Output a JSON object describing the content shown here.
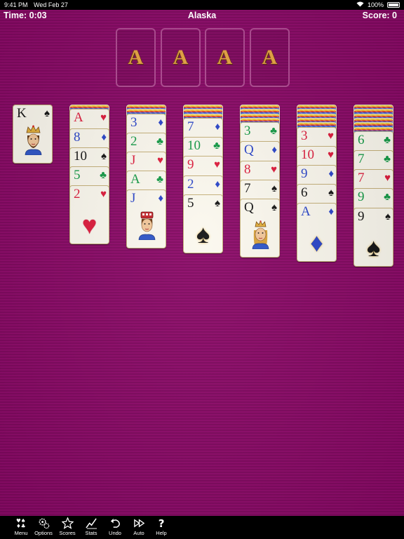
{
  "status": {
    "time": "9:41 PM",
    "date": "Wed Feb 27",
    "battery": "100%"
  },
  "header": {
    "time": "Time: 0:03",
    "title": "Alaska",
    "score": "Score: 0"
  },
  "foundations": [
    "A",
    "A",
    "A",
    "A"
  ],
  "waste": {
    "rank": "K",
    "suit": "♠",
    "face": "king"
  },
  "tableau": [
    {
      "facedown": 1,
      "cards": [
        {
          "rank": "A",
          "suit": "♥"
        },
        {
          "rank": "8",
          "suit": "♦"
        },
        {
          "rank": "10",
          "suit": "♠"
        },
        {
          "rank": "5",
          "suit": "♣"
        },
        {
          "rank": "2",
          "suit": "♥"
        }
      ]
    },
    {
      "facedown": 2,
      "cards": [
        {
          "rank": "3",
          "suit": "♦"
        },
        {
          "rank": "2",
          "suit": "♣"
        },
        {
          "rank": "J",
          "suit": "♥"
        },
        {
          "rank": "A",
          "suit": "♣"
        },
        {
          "rank": "J",
          "suit": "♦",
          "face": "jack"
        }
      ]
    },
    {
      "facedown": 3,
      "cards": [
        {
          "rank": "7",
          "suit": "♦"
        },
        {
          "rank": "10",
          "suit": "♣"
        },
        {
          "rank": "9",
          "suit": "♥"
        },
        {
          "rank": "2",
          "suit": "♦"
        },
        {
          "rank": "5",
          "suit": "♠"
        }
      ]
    },
    {
      "facedown": 4,
      "cards": [
        {
          "rank": "3",
          "suit": "♣"
        },
        {
          "rank": "Q",
          "suit": "♦"
        },
        {
          "rank": "8",
          "suit": "♥"
        },
        {
          "rank": "7",
          "suit": "♠"
        },
        {
          "rank": "Q",
          "suit": "♠",
          "face": "queen"
        }
      ]
    },
    {
      "facedown": 5,
      "cards": [
        {
          "rank": "3",
          "suit": "♥"
        },
        {
          "rank": "10",
          "suit": "♥"
        },
        {
          "rank": "9",
          "suit": "♦"
        },
        {
          "rank": "6",
          "suit": "♠"
        },
        {
          "rank": "A",
          "suit": "♦"
        }
      ]
    },
    {
      "facedown": 6,
      "cards": [
        {
          "rank": "6",
          "suit": "♣"
        },
        {
          "rank": "7",
          "suit": "♣"
        },
        {
          "rank": "7",
          "suit": "♥"
        },
        {
          "rank": "9",
          "suit": "♣"
        },
        {
          "rank": "9",
          "suit": "♠"
        }
      ]
    }
  ],
  "toolbar": [
    {
      "label": "Menu",
      "icon": "menu-suits-icon"
    },
    {
      "label": "Options",
      "icon": "gears-icon"
    },
    {
      "label": "Scores",
      "icon": "star-icon"
    },
    {
      "label": "Stats",
      "icon": "chart-icon"
    },
    {
      "label": "Undo",
      "icon": "undo-icon"
    },
    {
      "label": "Auto",
      "icon": "fast-forward-icon"
    },
    {
      "label": "Help",
      "icon": "question-icon"
    }
  ],
  "colors": {
    "felt": "#8e0a6a",
    "foundation_letter": "#e8a443",
    "heart": "#dd1c3c",
    "diamond": "#2a45c9",
    "club": "#149a46",
    "spade": "#141414"
  }
}
